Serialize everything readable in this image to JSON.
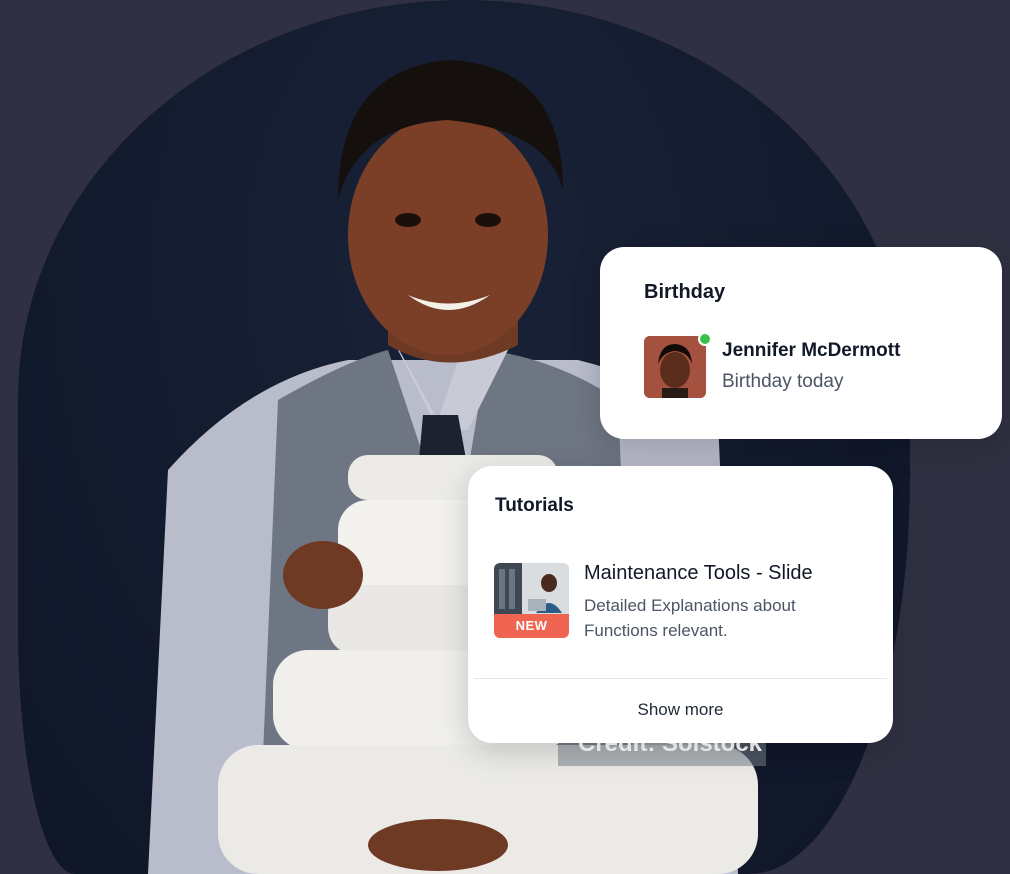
{
  "hero": {
    "credit_label": "Credit: Solstock"
  },
  "birthday": {
    "title": "Birthday",
    "person_name": "Jennifer McDermott",
    "person_sub": "Birthday today",
    "status_color": "#38c24a"
  },
  "tutorials": {
    "title": "Tutorials",
    "item_title": "Maintenance Tools - Slide",
    "item_desc": "Detailed Explanations about Functions relevant.",
    "badge": "NEW",
    "badge_color": "#f06452",
    "show_more": "Show more"
  },
  "colors": {
    "background": "#2f3142",
    "hero_background": "#121a2d",
    "card": "#ffffff"
  }
}
